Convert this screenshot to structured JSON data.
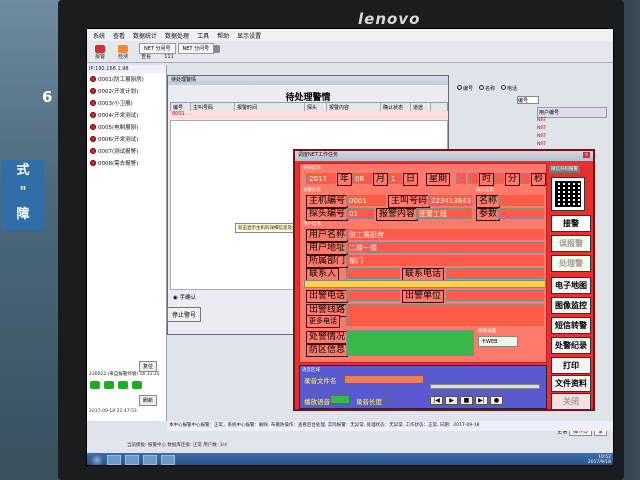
{
  "environment": {
    "wall_number": "6",
    "wall_sign": "式\n\"\n障",
    "monitor_brand": "lenovo"
  },
  "menubar": {
    "items": [
      "系统",
      "查看",
      "数据统计",
      "数据处理",
      "工具",
      "帮助",
      "显示设置"
    ]
  },
  "toolbar": {
    "buttons": [
      {
        "label": "报警",
        "icon": "alarm-icon"
      },
      {
        "label": "检测",
        "icon": "check-icon"
      },
      {
        "label": "查看",
        "icon": "view-icon"
      },
      {
        "label": "111",
        "icon": "phone-icon"
      },
      {
        "label": "",
        "icon": "blank-icon"
      },
      {
        "label": "",
        "icon": "blank-icon"
      }
    ],
    "tabs": [
      "NET 分问号",
      "NET 分问号"
    ]
  },
  "left_panel": {
    "ip": "IP:192.168.1.98",
    "items": [
      "0001(防工展厨房)",
      "0002(开发计划)",
      "0003(小卫展)",
      "0004(开发测试)",
      "0005(电制展厨)",
      "0006(开发测试)",
      "0007(测试报警)",
      "0008(需去报警)"
    ],
    "status": "230022 (来自报警终端) 16.11.25",
    "buttons": [
      "刷新",
      "复位"
    ],
    "time": "2017-09-18 22:47:53",
    "bottom_buttons": [
      "刷新"
    ]
  },
  "pending_window": {
    "title": "待处理警情",
    "window_title": "待处理警情",
    "columns": [
      "编号",
      "主叫号码",
      "报警时间",
      "探头",
      "报警内容",
      "确认状态",
      "道途"
    ],
    "rows": [
      {
        "id": "0001",
        "color": "#cc0000"
      }
    ],
    "check_label": "手确认",
    "stop_button": "停止警号"
  },
  "tooltip": "双击显示主机的详细信息及处理",
  "alarm_dialog": {
    "title": "调度NET工作任务",
    "section_time": "时间信息",
    "year": "2017",
    "year_label": "年",
    "month": "08",
    "month_label": "月",
    "day": "1",
    "day_label": "日",
    "weekday_label": "星期",
    "weekday": "",
    "hour_label": "时",
    "minute_label": "分",
    "second_label": "秒",
    "section_alarm": "报警信息",
    "host_id_label": "主机编号",
    "host_id": "0001",
    "caller_label": "主叫号码",
    "caller": "223413843",
    "name_label": "名称",
    "probe_label": "探头编号",
    "probe": "01",
    "content_label": "报警内容",
    "content": "匪警工程",
    "param_label": "参数",
    "section_probe": "探头信息",
    "section_user": "用户信息",
    "user_name_label": "用户名称",
    "user_name": "防工展厨房",
    "user_addr_label": "用户地址",
    "user_addr": "二楼一楼",
    "dept_label": "所属部门",
    "dept": "部门",
    "contact_label": "联系人",
    "contact_phone_label": "联系电话",
    "section_dispatch": "出警信息",
    "dispatch_phone_label": "出警电话",
    "dispatch_unit_label": "出警单位",
    "dispatch_route_label": "出警线路",
    "more_phones": "更多电话",
    "handle_label": "处警情况",
    "area_label": "防区信息",
    "map_label": "图像设置",
    "map_select": "卡WEB",
    "section_voice": "语音区域",
    "voice_file_label": "录音文件名",
    "voice_name": "",
    "voice_status_label": "录音长度",
    "voice_status": "",
    "voice_play_label": "播放语音",
    "voice_buttons": [
      "|◀",
      "▶",
      "■",
      "▶|",
      "●"
    ],
    "qr_label": "微信扫码报警",
    "side_buttons": [
      {
        "label": "接警",
        "enabled": true
      },
      {
        "label": "误报警",
        "enabled": false
      },
      {
        "label": "处理警",
        "enabled": false
      },
      {
        "label": "电子地图",
        "enabled": true
      },
      {
        "label": "图像监控",
        "enabled": true
      },
      {
        "label": "短信转警",
        "enabled": true
      },
      {
        "label": "处警纪录",
        "enabled": true
      },
      {
        "label": "打印",
        "enabled": true
      },
      {
        "label": "文件资料",
        "enabled": true
      },
      {
        "label": "关闭",
        "enabled": false
      }
    ]
  },
  "right_panel": {
    "radio_a": "编号",
    "radio_b": "名称",
    "radio_c": "电话",
    "select": "编号",
    "grid_header": "用户编号",
    "grid_rows": [
      "NRT",
      "NRT",
      "NRT",
      "NRT",
      "NRT",
      "NRT",
      "NRT",
      "NRT",
      "NRT",
      "NRT",
      "NRT",
      "NRT",
      "NRT",
      "NRT",
      "NRT",
      "NRT",
      "NRT",
      "NRT",
      "NRT",
      "NRT",
      "NRT",
      "NRT",
      "NRT",
      "NRT",
      "NRT",
      "NRT",
      "NRT",
      "NRT",
      "NRT",
      "NRT",
      "NRT",
      "NRT",
      "NRT",
      "NRT"
    ],
    "bottom_label": "主语",
    "bottom_select": "操作员",
    "bottom_btn": "录"
  },
  "statusbar": "本中心报警中心报警：正常，系统中心报警：删除, 布撤防操作：查看后台处理, 实际报警：无异常, 处理状态：无异常, 工作状态：正常, 日期：2017-09-18",
  "sysline": "当前模板: 报警中心  数据库连接: 正常  用户数: 3/4",
  "taskbar": {
    "clock_time": "10:52",
    "clock_date": "2017/9/18"
  },
  "colors": {
    "dialog_red": "#e8302e",
    "field_red": "#ff5a4a",
    "field_green": "#38b848",
    "field_yellow": "#ffd24a"
  }
}
